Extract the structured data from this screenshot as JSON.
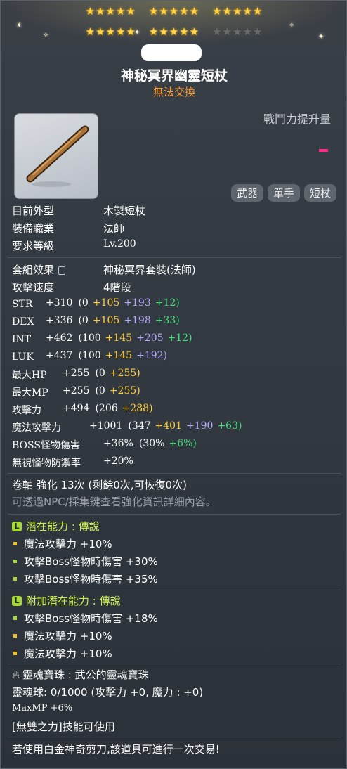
{
  "stars": {
    "row1_groups": 3,
    "row2_filled_groups": 2
  },
  "item": {
    "name": "神秘冥界幽靈短杖",
    "trade": "無法交換",
    "power_label": "戰鬥力提升量",
    "tags": [
      "武器",
      "單手",
      "短杖"
    ]
  },
  "info": [
    {
      "label": "目前外型",
      "value": "木製短杖"
    },
    {
      "label": "裝備職業",
      "value": "法師"
    },
    {
      "label": "要求等級",
      "value": "Lv.200"
    }
  ],
  "set": {
    "label": "套組效果",
    "value": "神秘冥界套裝(法師)"
  },
  "speed": {
    "label": "攻擊速度",
    "value": "4階段"
  },
  "stats": [
    {
      "label": "STR",
      "total": "+310",
      "base": "(0",
      "parts": [
        {
          "text": "+105",
          "c": "y"
        },
        {
          "text": "+193",
          "c": "p"
        },
        {
          "text": "+12)",
          "c": "g"
        }
      ]
    },
    {
      "label": "DEX",
      "total": "+336",
      "base": "(0",
      "parts": [
        {
          "text": "+105",
          "c": "y"
        },
        {
          "text": "+198",
          "c": "p"
        },
        {
          "text": "+33)",
          "c": "g"
        }
      ]
    },
    {
      "label": "INT",
      "total": "+462",
      "base": "(100",
      "parts": [
        {
          "text": "+145",
          "c": "y"
        },
        {
          "text": "+205",
          "c": "p"
        },
        {
          "text": "+12)",
          "c": "g"
        }
      ]
    },
    {
      "label": "LUK",
      "total": "+437",
      "base": "(100",
      "parts": [
        {
          "text": "+145",
          "c": "y"
        },
        {
          "text": "+192)",
          "c": "p"
        }
      ]
    },
    {
      "label": "最大HP",
      "total": "+255",
      "base": "(0",
      "parts": [
        {
          "text": "+255)",
          "c": "y"
        }
      ]
    },
    {
      "label": "最大MP",
      "total": "+255",
      "base": "(0",
      "parts": [
        {
          "text": "+255)",
          "c": "y"
        }
      ]
    },
    {
      "label": "攻擊力",
      "total": "+494",
      "base": "(206",
      "parts": [
        {
          "text": "+288)",
          "c": "y"
        }
      ]
    },
    {
      "label": "魔法攻擊力",
      "total": "+1001",
      "base": "(347",
      "parts": [
        {
          "text": "+401",
          "c": "y"
        },
        {
          "text": "+190",
          "c": "p"
        },
        {
          "text": "+63)",
          "c": "g"
        }
      ]
    },
    {
      "label": "BOSS怪物傷害",
      "total": "+36%",
      "base": "(30%",
      "parts": [
        {
          "text": "+6%)",
          "c": "g"
        }
      ]
    },
    {
      "label": "無視怪物防禦率",
      "total": "+20%",
      "base": "",
      "parts": []
    }
  ],
  "scroll": {
    "text": "卷軸 強化 13次 (剩餘0次,可恢復0次)",
    "hint": "可透過NPC/採集鍵查看強化資訊詳細內容。"
  },
  "potential": {
    "title": "潛在能力 : 傳說",
    "badge": "L",
    "lines": [
      "魔法攻擊力 +10%",
      "攻擊Boss怪物時傷害 +30%",
      "攻擊Boss怪物時傷害 +35%"
    ]
  },
  "additional": {
    "title": "附加潛在能力 : 傳說",
    "badge": "L",
    "lines": [
      "攻擊Boss怪物時傷害 +18%",
      "魔法攻擊力 +10%",
      "魔法攻擊力 +10%"
    ]
  },
  "soul": {
    "title": "靈魂寶珠 : 武公的靈魂寶珠",
    "orb": "靈魂球: 0/1000 (攻擊力 +0, 魔力 : +0)",
    "mp": "MaxMP +6%",
    "skill": "[無雙之力]技能可使用"
  },
  "footer": "若使用白金神奇剪刀,該道具可進行一次交易!",
  "colors": {
    "gold": "#ffcc33",
    "purple": "#b8a8ff",
    "green": "#44e07a",
    "lime": "#ccf04a",
    "orange": "#ff9a2e",
    "pink": "#ff2a8a"
  }
}
